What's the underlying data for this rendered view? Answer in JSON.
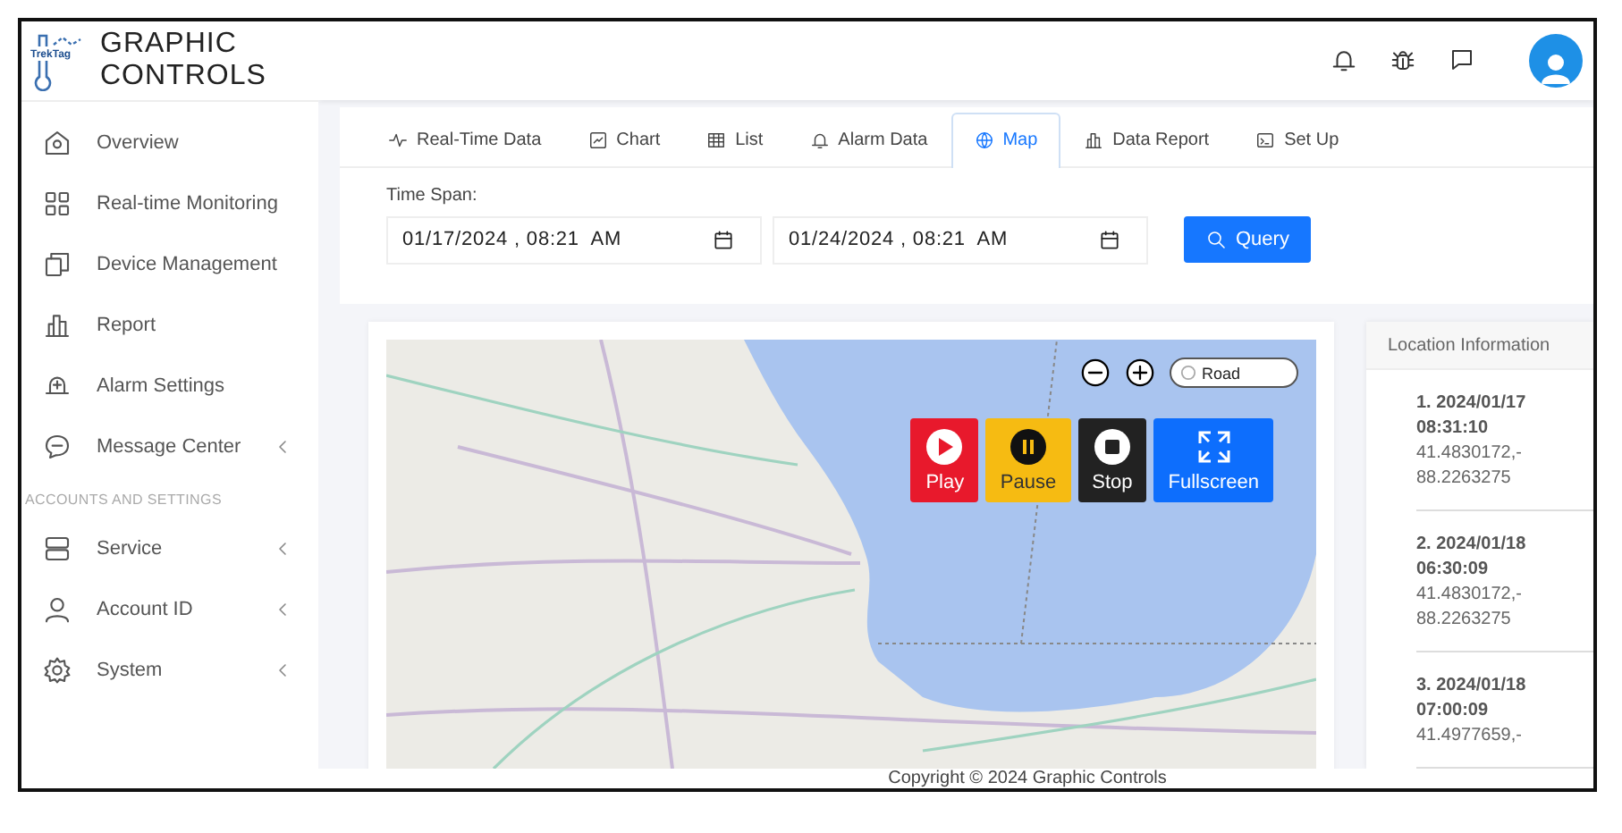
{
  "logo": {
    "line_1": "GRAPHIC",
    "line_2": "CONTROLS",
    "badge": "TrekTag"
  },
  "sidebar": {
    "items": [
      {
        "label": "Overview",
        "expandable": false
      },
      {
        "label": "Real-time Monitoring",
        "expandable": false
      },
      {
        "label": "Device Management",
        "expandable": false
      },
      {
        "label": "Report",
        "expandable": false
      },
      {
        "label": "Alarm Settings",
        "expandable": false
      },
      {
        "label": "Message Center",
        "expandable": true
      }
    ],
    "section_heading": "ACCOUNTS AND SETTINGS",
    "section_items": [
      {
        "label": "Service",
        "expandable": true
      },
      {
        "label": "Account ID",
        "expandable": true
      },
      {
        "label": "System",
        "expandable": true
      }
    ]
  },
  "tabs": [
    {
      "label": "Real-Time Data",
      "selected": false
    },
    {
      "label": "Chart",
      "selected": false
    },
    {
      "label": "List",
      "selected": false
    },
    {
      "label": "Alarm Data",
      "selected": false
    },
    {
      "label": "Map",
      "selected": true
    },
    {
      "label": "Data Report",
      "selected": false
    },
    {
      "label": "Set Up",
      "selected": false
    }
  ],
  "time_span": {
    "label": "Time Span:",
    "start": "01/17/2024 , 08:21  AM",
    "end": "01/24/2024 , 08:21  AM",
    "button": "Query"
  },
  "map": {
    "map_type": "Road",
    "playback": [
      {
        "label": "Play",
        "color": "#e8192c"
      },
      {
        "label": "Pause",
        "color": "#f6bb12"
      },
      {
        "label": "Stop",
        "color": "#222222"
      },
      {
        "label": "Fullscreen",
        "color": "#0d6efd"
      }
    ]
  },
  "location_info": {
    "title": "Location Information",
    "entries": [
      {
        "time": "1. 2024/01/17 08:31:10",
        "coords": "41.4830172,-88.2263275"
      },
      {
        "time": "2. 2024/01/18 06:30:09",
        "coords": "41.4830172,-88.2263275"
      },
      {
        "time": "3. 2024/01/18 07:00:09",
        "coords": "41.4977659,-"
      }
    ]
  },
  "footer": "Copyright © 2024 Graphic Controls"
}
